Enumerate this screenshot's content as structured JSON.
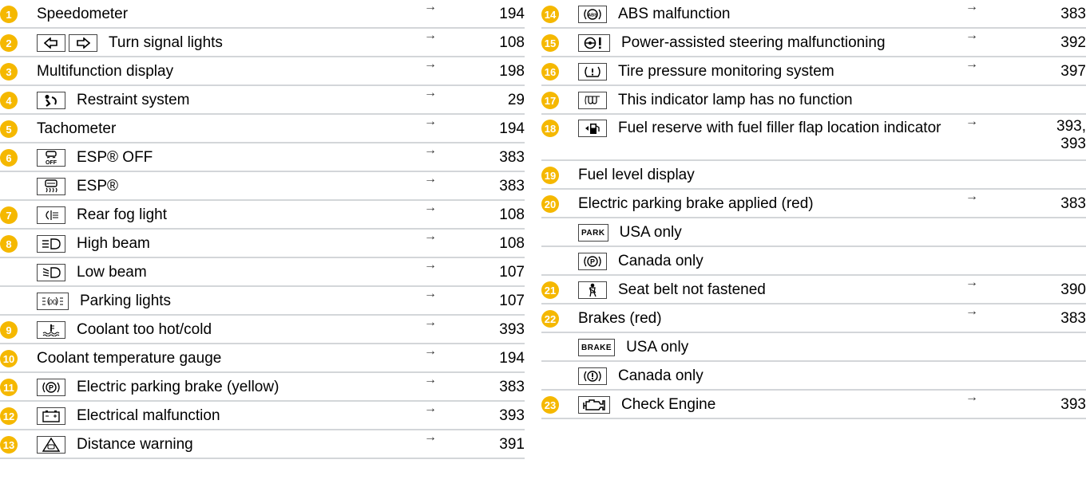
{
  "left": [
    {
      "num": "1",
      "icons": [],
      "label": "Speedometer",
      "arrow": "→",
      "page": "194"
    },
    {
      "num": "2",
      "icons": [
        "turn-left-arrow-icon",
        "turn-right-arrow-icon"
      ],
      "label": "Turn signal lights",
      "arrow": "→",
      "page": "108"
    },
    {
      "num": "3",
      "icons": [],
      "label": "Multifunction display",
      "arrow": "→",
      "page": "198"
    },
    {
      "num": "4",
      "icons": [
        "restraint-airbag-icon"
      ],
      "label": "Restraint system",
      "arrow": "→",
      "page": "29"
    },
    {
      "num": "5",
      "icons": [],
      "label": "Tachometer",
      "arrow": "→",
      "page": "194"
    },
    {
      "num": "6",
      "icons": [
        "esp-off-icon"
      ],
      "label": "ESP® OFF",
      "arrow": "→",
      "page": "383"
    },
    {
      "num": "",
      "icons": [
        "esp-skid-icon"
      ],
      "label": "ESP®",
      "arrow": "→",
      "page": "383"
    },
    {
      "num": "7",
      "icons": [
        "rear-fog-light-icon"
      ],
      "label": "Rear fog light",
      "arrow": "→",
      "page": "108"
    },
    {
      "num": "8",
      "icons": [
        "high-beam-icon"
      ],
      "label": "High beam",
      "arrow": "→",
      "page": "108"
    },
    {
      "num": "",
      "icons": [
        "low-beam-icon"
      ],
      "label": "Low beam",
      "arrow": "→",
      "page": "107"
    },
    {
      "num": "",
      "icons": [
        "parking-lights-icon"
      ],
      "label": "Parking lights",
      "arrow": "→",
      "page": "107"
    },
    {
      "num": "9",
      "icons": [
        "coolant-temperature-icon"
      ],
      "label": "Coolant too hot/cold",
      "arrow": "→",
      "page": "393"
    },
    {
      "num": "10",
      "icons": [],
      "label": "Coolant temperature gauge",
      "arrow": "→",
      "page": "194"
    },
    {
      "num": "11",
      "icons": [
        "parking-brake-p-icon"
      ],
      "label": "Electric parking brake (yellow)",
      "arrow": "→",
      "page": "383"
    },
    {
      "num": "12",
      "icons": [
        "battery-icon"
      ],
      "label": "Electrical malfunction",
      "arrow": "→",
      "page": "393"
    },
    {
      "num": "13",
      "icons": [
        "distance-warning-icon"
      ],
      "label": "Distance warning",
      "arrow": "→",
      "page": "391"
    }
  ],
  "right": [
    {
      "num": "14",
      "icons": [
        "abs-icon"
      ],
      "label": "ABS malfunction",
      "arrow": "→",
      "page": "383"
    },
    {
      "num": "15",
      "icons": [
        "steering-wheel-warning-icon"
      ],
      "label": "Power-assisted steering malfunctioning",
      "arrow": "→",
      "page": "392"
    },
    {
      "num": "16",
      "icons": [
        "tire-pressure-icon"
      ],
      "label": "Tire pressure monitoring system",
      "arrow": "→",
      "page": "397"
    },
    {
      "num": "17",
      "icons": [
        "glow-plug-icon"
      ],
      "label": "This indicator lamp has no function",
      "arrow": "",
      "page": ""
    },
    {
      "num": "18",
      "icons": [
        "fuel-pump-icon"
      ],
      "label": "Fuel reserve with fuel filler flap location indicator",
      "arrow": "→",
      "page": "393, 393"
    },
    {
      "num": "19",
      "icons": [],
      "label": "Fuel level display",
      "arrow": "",
      "page": ""
    },
    {
      "num": "20",
      "icons": [],
      "label": "Electric parking brake applied (red)",
      "arrow": "→",
      "page": "383"
    },
    {
      "num": "",
      "icons": [
        "park-text-icon"
      ],
      "icon_text": "PARK",
      "label": "USA only",
      "arrow": "",
      "page": ""
    },
    {
      "num": "",
      "icons": [
        "parking-brake-p-icon"
      ],
      "label": "Canada only",
      "arrow": "",
      "page": ""
    },
    {
      "num": "21",
      "icons": [
        "seat-belt-icon"
      ],
      "label": "Seat belt not fastened",
      "arrow": "→",
      "page": "390"
    },
    {
      "num": "22",
      "icons": [],
      "label": "Brakes (red)",
      "arrow": "→",
      "page": "383"
    },
    {
      "num": "",
      "icons": [
        "brake-text-icon"
      ],
      "icon_text": "BRAKE",
      "label": "USA only",
      "arrow": "",
      "page": ""
    },
    {
      "num": "",
      "icons": [
        "brake-warning-icon"
      ],
      "label": "Canada only",
      "arrow": "",
      "page": ""
    },
    {
      "num": "23",
      "icons": [
        "check-engine-icon"
      ],
      "label": "Check Engine",
      "arrow": "→",
      "page": "393"
    }
  ],
  "colors": {
    "badge": "#f5b800",
    "rule": "#d3d6d9"
  }
}
